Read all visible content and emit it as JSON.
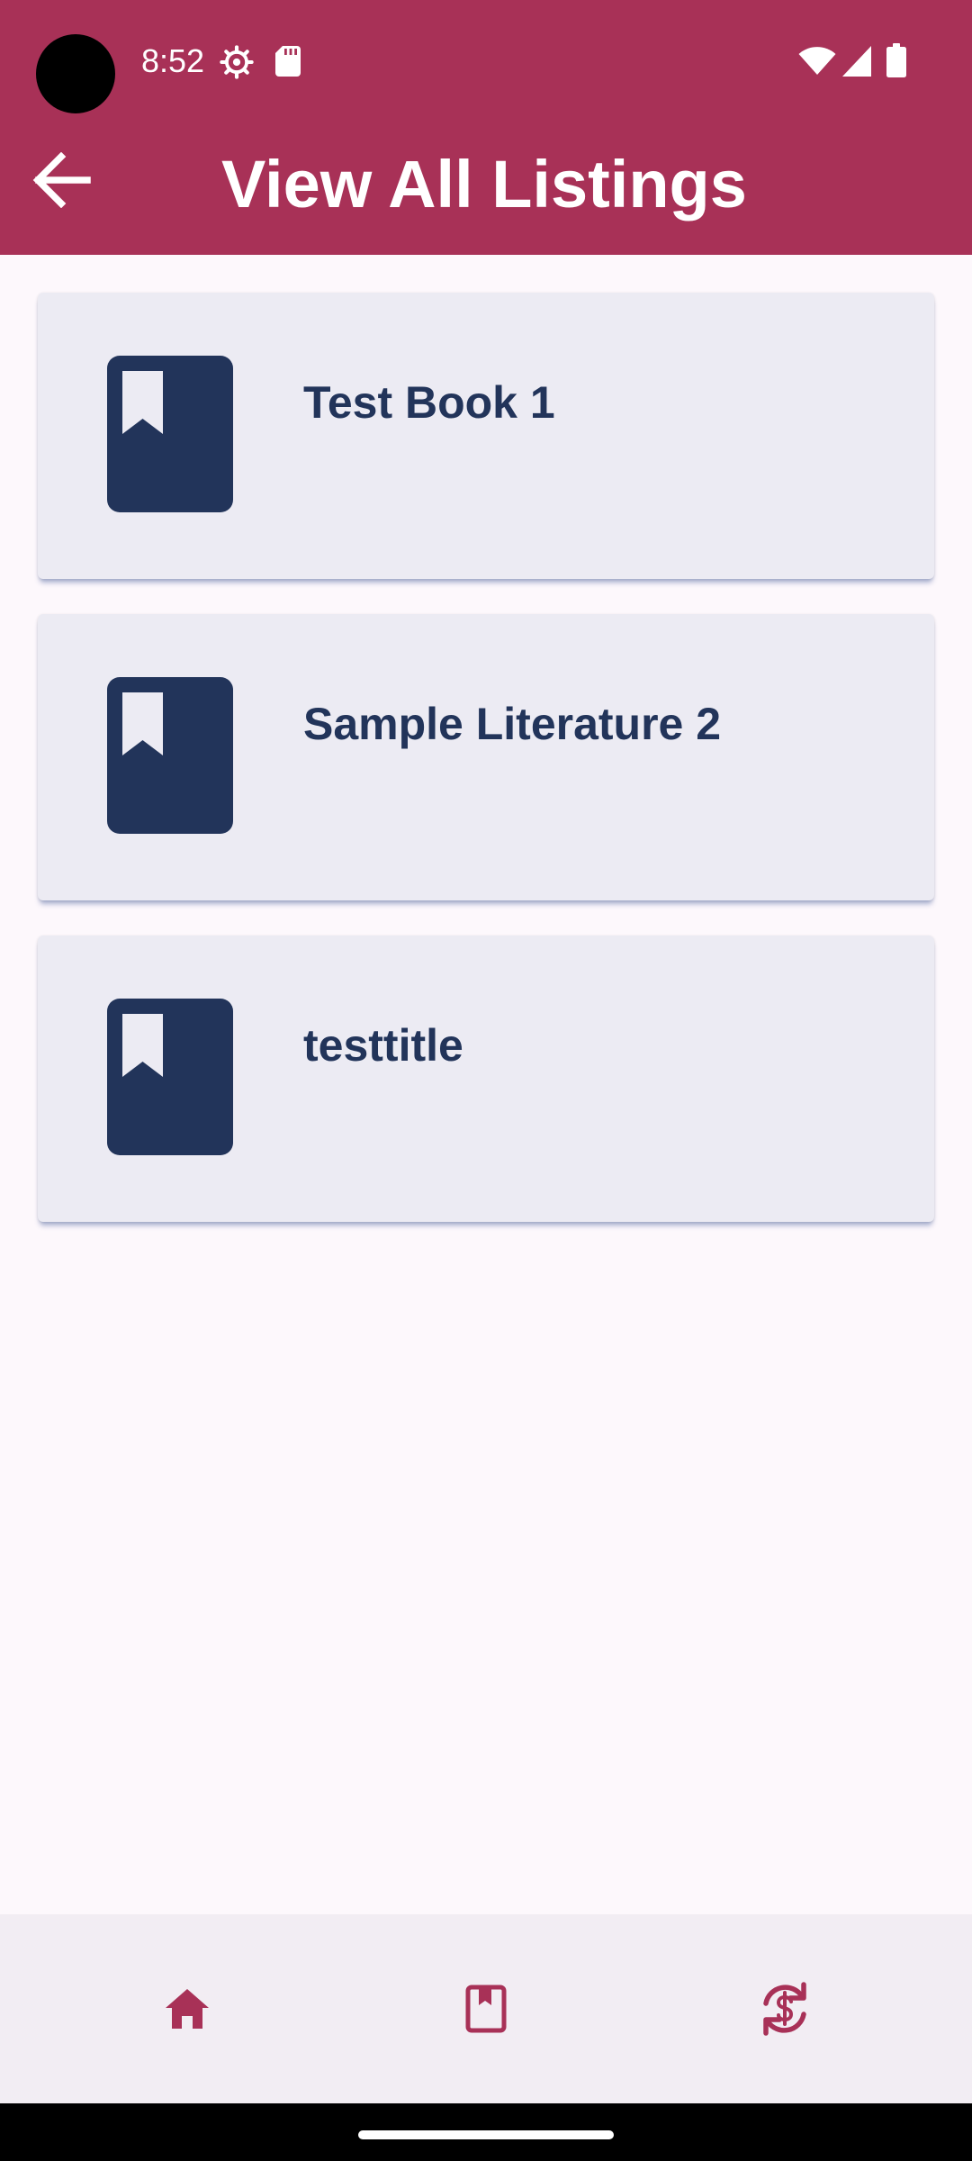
{
  "colors": {
    "app_bar": "#a83157",
    "card_background": "#ecebf3",
    "card_text": "#22345a",
    "book_icon": "#22345a",
    "nav_icon": "#a83157",
    "page_background": "#fdf8fc",
    "nav_background": "#f2edf3"
  },
  "status_bar": {
    "time": "8:52",
    "left_icons": [
      "settings-icon",
      "sd-card-icon"
    ],
    "right_icons": [
      "wifi-icon",
      "cellular-signal-icon",
      "battery-icon"
    ]
  },
  "toolbar": {
    "title": "View All Listings",
    "back_icon": "arrow-back-icon"
  },
  "listings": [
    {
      "title": "Test Book 1",
      "icon": "book-bookmark-icon"
    },
    {
      "title": "Sample Literature 2",
      "icon": "book-bookmark-icon"
    },
    {
      "title": "testtitle",
      "icon": "book-bookmark-icon"
    }
  ],
  "bottom_nav": {
    "items": [
      {
        "icon": "home-icon"
      },
      {
        "icon": "book-icon"
      },
      {
        "icon": "currency-exchange-icon"
      }
    ]
  }
}
